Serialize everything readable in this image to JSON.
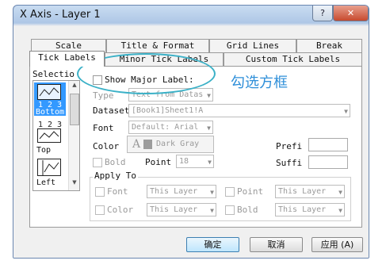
{
  "window": {
    "title": "X Axis - Layer 1",
    "help_label": "?",
    "close_label": "✕"
  },
  "tabs_back": [
    "Scale",
    "Title & Format",
    "Grid Lines",
    "Break"
  ],
  "tabs_front": [
    "Tick Labels",
    "Minor Tick Labels",
    "Custom Tick Labels"
  ],
  "selection": {
    "heading": "Selectio",
    "items": [
      {
        "label": "Bottom",
        "selected": true
      },
      {
        "label": "Top",
        "selected": false
      },
      {
        "label": "Left",
        "selected": false
      }
    ]
  },
  "form": {
    "show_major_label": "Show Major Label:",
    "type_label": "Type",
    "type_value": "Text from Datas",
    "dataset_label": "Dataset",
    "dataset_value": "[Book1]Sheet1!A",
    "font_label": "Font",
    "font_value": "Default: Arial",
    "color_label": "Color",
    "color_letter": "A",
    "color_value": "Dark Gray",
    "bold_label": "Bold",
    "point_label": "Point",
    "point_value": "18",
    "prefix_label": "Prefi",
    "suffix_label": "Suffi",
    "apply_to_label": "Apply To",
    "apply_rows": [
      {
        "left_label": "Font",
        "left_value": "This Layer",
        "right_label": "Point",
        "right_value": "This Layer"
      },
      {
        "left_label": "Color",
        "left_value": "This Layer",
        "right_label": "Bold",
        "right_value": "This Layer"
      }
    ]
  },
  "annotation": {
    "text": "勾选方框",
    "color": "#2f8fd9"
  },
  "buttons": {
    "ok": "确定",
    "cancel": "取消",
    "apply": "应用 (A)"
  },
  "colors": {
    "swatch": "#9c9c9c",
    "ellipse": "#3bb1c7",
    "selected_item": "#3399ff"
  }
}
